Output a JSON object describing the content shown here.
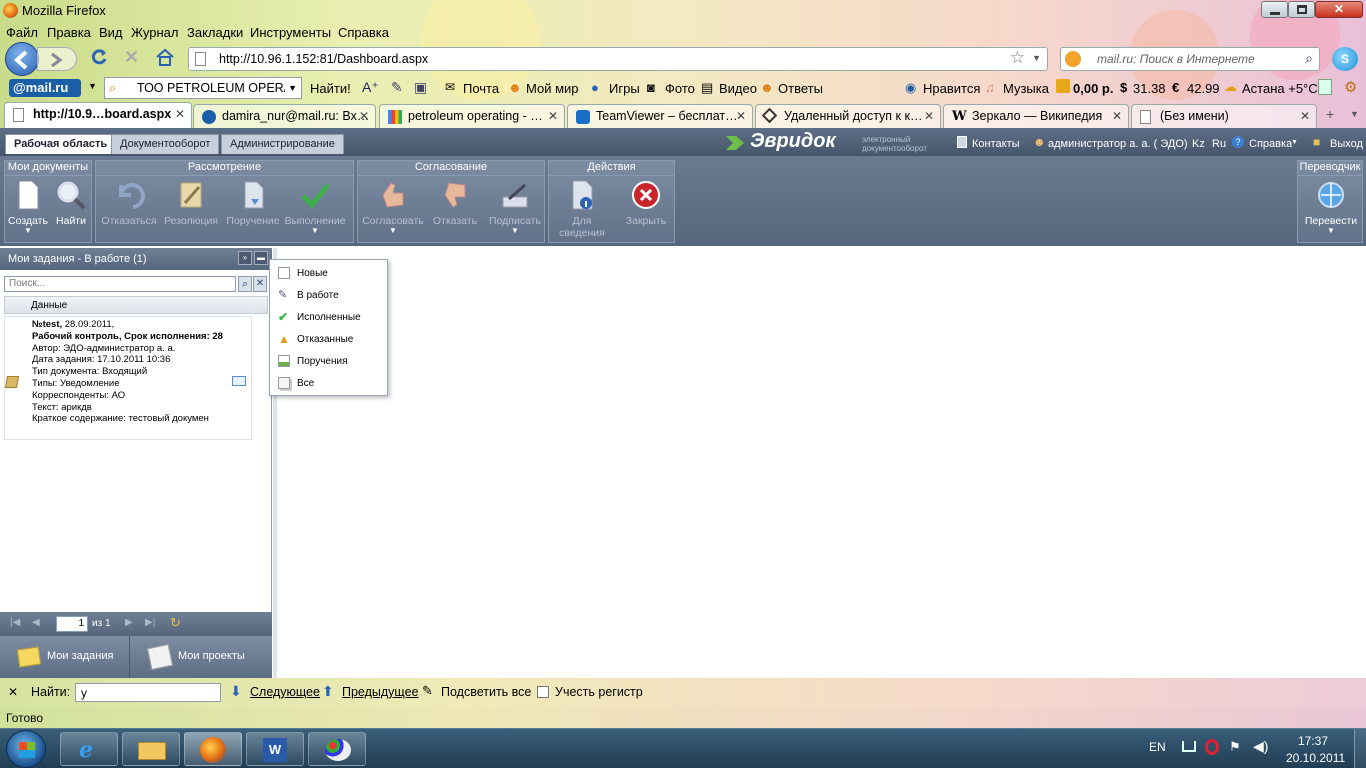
{
  "window": {
    "title": "Mozilla Firefox"
  },
  "menubar": [
    "Файл",
    "Правка",
    "Вид",
    "Журнал",
    "Закладки",
    "Инструменты",
    "Справка"
  ],
  "navbar": {
    "url": "http://10.96.1.152:81/Dashboard.aspx",
    "search_placeholder": "mail.ru: Поиск в Интернете"
  },
  "mailru_toolbar": {
    "logo": "@mail.ru",
    "search_value": "ТОО PETROLEUM OPERATI",
    "find_button": "Найти!",
    "items": [
      "Почта",
      "Мой мир",
      "Игры",
      "Фото",
      "Видео",
      "Ответы",
      "Нравится",
      "Музыка"
    ],
    "balance": "0,00 р.",
    "usd": "31.38",
    "eur": "42.99",
    "weather": "Астана +5°C"
  },
  "tabs": [
    {
      "label": "http://10.9…board.aspx",
      "active": true
    },
    {
      "label": "damira_nur@mail.ru: Вх…"
    },
    {
      "label": "petroleum operating - …"
    },
    {
      "label": "TeamViewer – бесплат…"
    },
    {
      "label": "Удаленный доступ к к…"
    },
    {
      "label": "Зеркало — Википедия"
    },
    {
      "label": "(Без имени)"
    }
  ],
  "app": {
    "nav_tabs": [
      "Рабочая область",
      "Документооборот",
      "Администрирование"
    ],
    "brand": {
      "name": "Эвридок",
      "tagline_line1": "электронный",
      "tagline_line2": "документооборот"
    },
    "topright": {
      "contacts": "Контакты",
      "user": "администратор а. а. ( ЭДО)",
      "lang_kz": "Kz",
      "lang_ru": "Ru",
      "help": "Справка",
      "exit": "Выход"
    },
    "ribbon": {
      "groups": [
        {
          "title": "Мои документы",
          "buttons": [
            "Создать",
            "Найти"
          ]
        },
        {
          "title": "Рассмотрение",
          "buttons": [
            "Отказаться",
            "Резолюция",
            "Поручение",
            "Выполнение"
          ]
        },
        {
          "title": "Согласование",
          "buttons": [
            "Согласовать",
            "Отказать",
            "Подписать"
          ]
        },
        {
          "title": "Действия",
          "buttons": [
            "Для сведения",
            "Закрыть"
          ]
        },
        {
          "title": "Переводчик",
          "buttons": [
            "Перевести"
          ]
        }
      ]
    },
    "leftpanel": {
      "title": "Мои задания - В работе (1)",
      "search_placeholder": "Поиск...",
      "column": "Данные",
      "card": {
        "line1_bold": "№test,",
        "line1_rest": " 28.09.2011,",
        "line2": "Рабочий контроль, Срок исполнения: 28",
        "author": "Автор: ЭДО-администратор а. а.",
        "date": "Дата задания: 17.10.2011 10:36",
        "doctype": "Тип документа: Входящий",
        "types": "Типы: Уведомление",
        "corr": "Корреспонденты: АО",
        "text": "Текст: арикдв",
        "summary": "Краткое содержание: тестовый докумен"
      },
      "pager": {
        "page": "1",
        "of": "из 1"
      },
      "bottom": {
        "tasks": "Мои задания",
        "projects": "Мои проекты"
      }
    },
    "dropdown": [
      "Новые",
      "В работе",
      "Исполненные",
      "Отказанные",
      "Поручения",
      "Все"
    ]
  },
  "findbar": {
    "label": "Найти:",
    "value": "у",
    "next": "Следующее",
    "prev": "Предыдущее",
    "highlight": "Подсветить все",
    "match_case": "Учесть регистр"
  },
  "status": "Готово",
  "taskbar": {
    "lang": "EN",
    "time": "17:37",
    "date": "20.10.2011"
  }
}
